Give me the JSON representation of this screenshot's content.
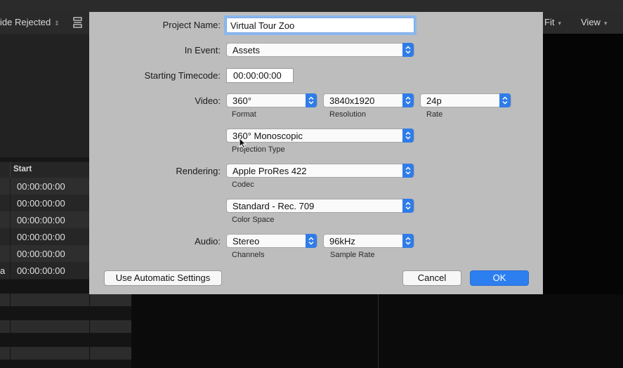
{
  "toolbar": {
    "filter_label": "ide Rejected",
    "fit_label": "Fit",
    "view_label": "View"
  },
  "browser_list": {
    "column_header": "Start",
    "rows": [
      "00:00:00:00",
      "00:00:00:00",
      "00:00:00:00",
      "00:00:00:00",
      "00:00:00:00",
      "00:00:00:00"
    ],
    "last_row_fragment": "a"
  },
  "dialog": {
    "project_name_label": "Project Name:",
    "project_name_value": "Virtual Tour Zoo",
    "in_event_label": "In Event:",
    "in_event_value": "Assets",
    "timecode_label": "Starting Timecode:",
    "timecode_value": "00:00:00:00",
    "video_label": "Video:",
    "format_value": "360°",
    "format_caption": "Format",
    "resolution_value": "3840x1920",
    "resolution_caption": "Resolution",
    "rate_value": "24p",
    "rate_caption": "Rate",
    "projection_value": "360° Monoscopic",
    "projection_caption": "Projection Type",
    "rendering_label": "Rendering:",
    "codec_value": "Apple ProRes 422",
    "codec_caption": "Codec",
    "colorspace_value": "Standard - Rec. 709",
    "colorspace_caption": "Color Space",
    "audio_label": "Audio:",
    "channels_value": "Stereo",
    "channels_caption": "Channels",
    "samplerate_value": "96kHz",
    "samplerate_caption": "Sample Rate",
    "auto_settings_label": "Use Automatic Settings",
    "cancel_label": "Cancel",
    "ok_label": "OK"
  },
  "colors": {
    "accent": "#2d7ff0",
    "dialog_bg": "#bdbdbd",
    "app_bg": "#1e1e1e"
  },
  "icons": [
    "chevron-updown-icon",
    "layout-icon",
    "chevron-down-icon",
    "mouse-cursor-icon"
  ]
}
